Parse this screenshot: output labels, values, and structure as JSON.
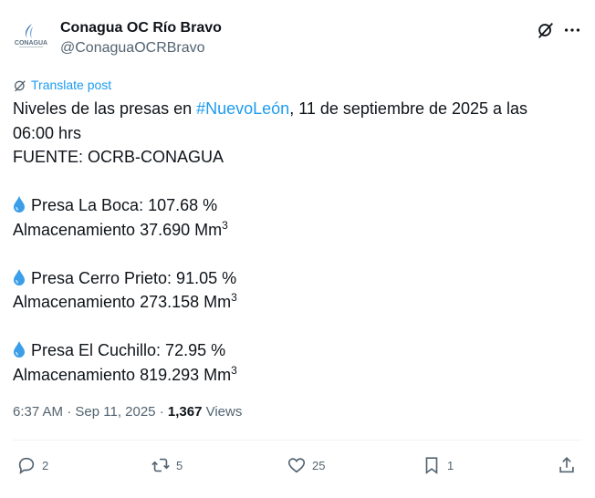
{
  "tweet": {
    "account_name": "Conagua OC Río Bravo",
    "handle": "@ConaguaOCRBravo",
    "avatar_text": "CONAGUA",
    "translate_label": "Translate post",
    "text": {
      "line1_pre": "Niveles de las presas en ",
      "line1_hashtag": "#NuevoLeón",
      "line1_post": ", 11 de septiembre de 2025 a las",
      "line2": "06:00 hrs",
      "line3": "FUENTE: OCRB-CONAGUA",
      "dams": [
        {
          "name_line": "Presa La Boca: 107.68 %",
          "storage_line": "Almacenamiento 37.690 Mm",
          "sup": "3"
        },
        {
          "name_line": "Presa Cerro Prieto: 91.05 %",
          "storage_line": "Almacenamiento 273.158 Mm",
          "sup": "3"
        },
        {
          "name_line": "Presa El Cuchillo: 72.95 %",
          "storage_line": "Almacenamiento 819.293 Mm",
          "sup": "3"
        }
      ]
    },
    "meta": {
      "time": "6:37 AM",
      "sep1": " · ",
      "date": "Sep 11, 2025",
      "sep2": " · ",
      "views_count": "1,367",
      "views_label": " Views"
    },
    "actions": {
      "replies": "2",
      "reposts": "5",
      "likes": "25",
      "bookmarks": "1"
    }
  },
  "colors": {
    "accent": "#1d9bf0",
    "text": "#0f1419",
    "secondary": "#536471",
    "drop": "#3a9ee8"
  },
  "icons": [
    "grok-icon",
    "more-icon",
    "translate-icon",
    "droplet-icon",
    "reply-icon",
    "repost-icon",
    "like-icon",
    "bookmark-icon",
    "share-icon"
  ]
}
